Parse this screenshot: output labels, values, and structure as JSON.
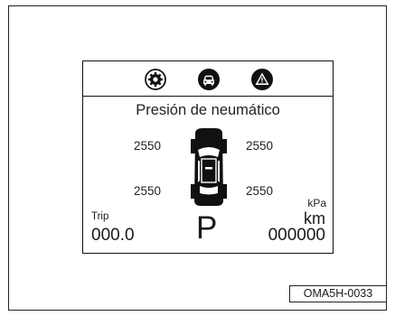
{
  "display": {
    "icons": [
      "gear-icon",
      "car-icon",
      "warning-triangle-icon"
    ],
    "title": "Presión de neumático",
    "tires": {
      "front_left": "2550",
      "front_right": "2550",
      "rear_left": "2550",
      "rear_right": "2550"
    },
    "pressure_unit": "kPa",
    "trip_label": "Trip",
    "trip_value": "000.0",
    "gear": "P",
    "odometer_unit": "km",
    "odometer_value": "000000"
  },
  "figure_code": "OMA5H-0033"
}
